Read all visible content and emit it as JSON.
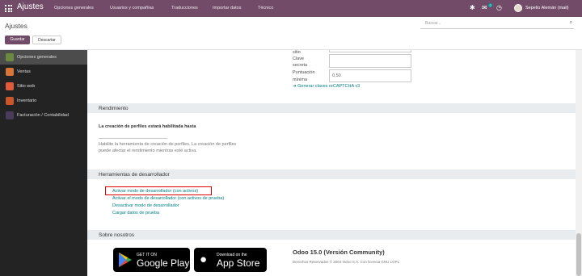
{
  "topbar": {
    "brand": "Ajustes",
    "menu": [
      "Opciones generales",
      "Usuarios y compañías",
      "Traducciones",
      "Importar datos",
      "Técnico"
    ],
    "user": "Sepelio Alemán (mail)",
    "chat_badge": "2"
  },
  "control": {
    "breadcrumb": "Ajustes",
    "search_placeholder": "Buscar...",
    "save_label": "Guardar",
    "discard_label": "Descartar"
  },
  "sidebar": {
    "items": [
      {
        "label": "Opciones generales",
        "color": "#6c8a3f"
      },
      {
        "label": "Ventas",
        "color": "#d9743a"
      },
      {
        "label": "Sitio web",
        "color": "#e05a3b"
      },
      {
        "label": "Inventario",
        "color": "#c9572a"
      },
      {
        "label": "Facturación / Contabilidad",
        "color": "#4a3b5a"
      }
    ]
  },
  "recaptcha": {
    "label_1": "sitio",
    "label_2": "Clave",
    "label_3": "secreta",
    "label_4": "Puntuación",
    "label_5": "mínima",
    "min_score": "0,50",
    "link": "➜ Generar claves reCAPTCHA v3"
  },
  "rendimiento": {
    "title": "Rendimiento",
    "option_title": "La creación de perfiles estará habilitada hasta",
    "help_1": "Habilite la herramienta de creación de perfiles. La creación de perfiles",
    "help_2": "puede afectar el rendimiento mientras esté activa."
  },
  "dev": {
    "title": "Herramientas de desarrollador",
    "links": [
      "Activar modo de desarrollador (con activos)",
      "Activar el modo de desarrollador (con activos de prueba)",
      "Desactivar modo de desarrollador",
      "Cargar datos de prueba"
    ]
  },
  "about": {
    "title": "Sobre nosotros",
    "google_small": "GET IT ON",
    "google_big": "Google Play",
    "apple_small": "Download on the",
    "apple_big": "App Store",
    "version": "Odoo 15.0 (Versión Community)",
    "rights": "Derechos Reservados © 2004 Odoo S.A. Con licencia GNU LGPL"
  }
}
